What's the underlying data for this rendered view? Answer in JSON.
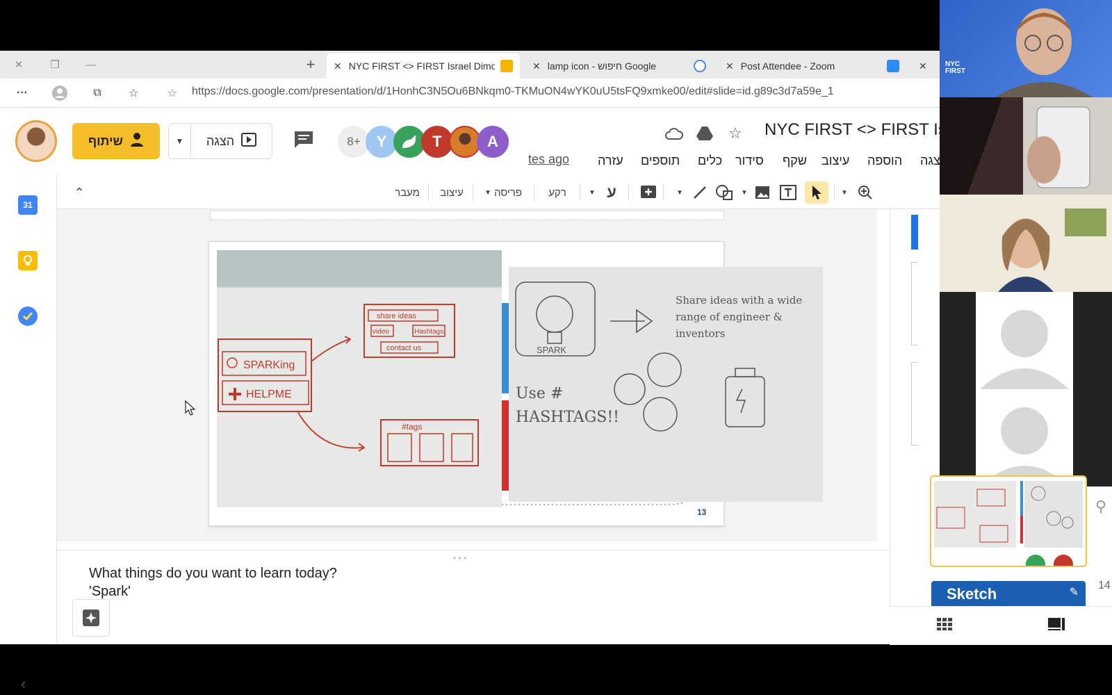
{
  "browser": {
    "tabs": [
      {
        "title": "NYC FIRST <> FIRST Israel Dimon",
        "active": true,
        "icon_color": "#f4b400"
      },
      {
        "title": "lamp icon - חיפוש Google",
        "active": false,
        "icon_color": "#4285f4"
      },
      {
        "title": "Post Attendee - Zoom",
        "active": false,
        "icon_color": "#2d8cff"
      }
    ],
    "new_tab_label": "+",
    "close_glyph": "✕",
    "url": "https://docs.google.com/presentation/d/1HonhC3N5Ou6BNkqm0-TKMuON4wYK0uU5tsFQ9xmke00/edit#slide=id.g89c3d7a59e_1",
    "overflow_glyph": "···"
  },
  "app": {
    "title": "NYC FIRST <> FIRST Is",
    "share_label": "שיתוף",
    "present_label": "הצגה",
    "collaborators_more": "8+",
    "collaborators": [
      {
        "initial": "Y",
        "color": "#9ec8ef"
      },
      {
        "initial": "",
        "color": "#3aa35b"
      },
      {
        "initial": "T",
        "color": "#c0392b"
      },
      {
        "initial": "",
        "color": "#d97c2a"
      },
      {
        "initial": "A",
        "color": "#8e5ec9"
      }
    ],
    "last_edit": "tes ago",
    "menu": [
      "עזרה",
      "תוספים",
      "כלים",
      "סידור",
      "שקף",
      "עיצוב",
      "הוספה",
      "הצגה"
    ],
    "toolbar": {
      "transition": "מעבר",
      "design": "עיצוב",
      "layout": "פריסה",
      "background": "רקע",
      "text_glyph": "ע"
    }
  },
  "slide": {
    "number": "13",
    "left_sketch": {
      "box1": [
        "share ideas",
        "video",
        "Hashtags",
        "contact us"
      ],
      "box2": [
        "SPARKing",
        "HELPME"
      ],
      "box3": [
        "#tags"
      ]
    },
    "right_sketch": {
      "icon_label": "SPARK",
      "text1": "Share ideas with a wide range of engineer & inventors",
      "text2": "Use # HASHTAGS!!!"
    }
  },
  "notes": {
    "line1": "What things do you want to learn today?",
    "line2": "'Spark'"
  },
  "filmstrip": {
    "next_label": "Sketch",
    "next_number": "14"
  },
  "zoom": {
    "host_logo_text": "NYC FIRST"
  }
}
